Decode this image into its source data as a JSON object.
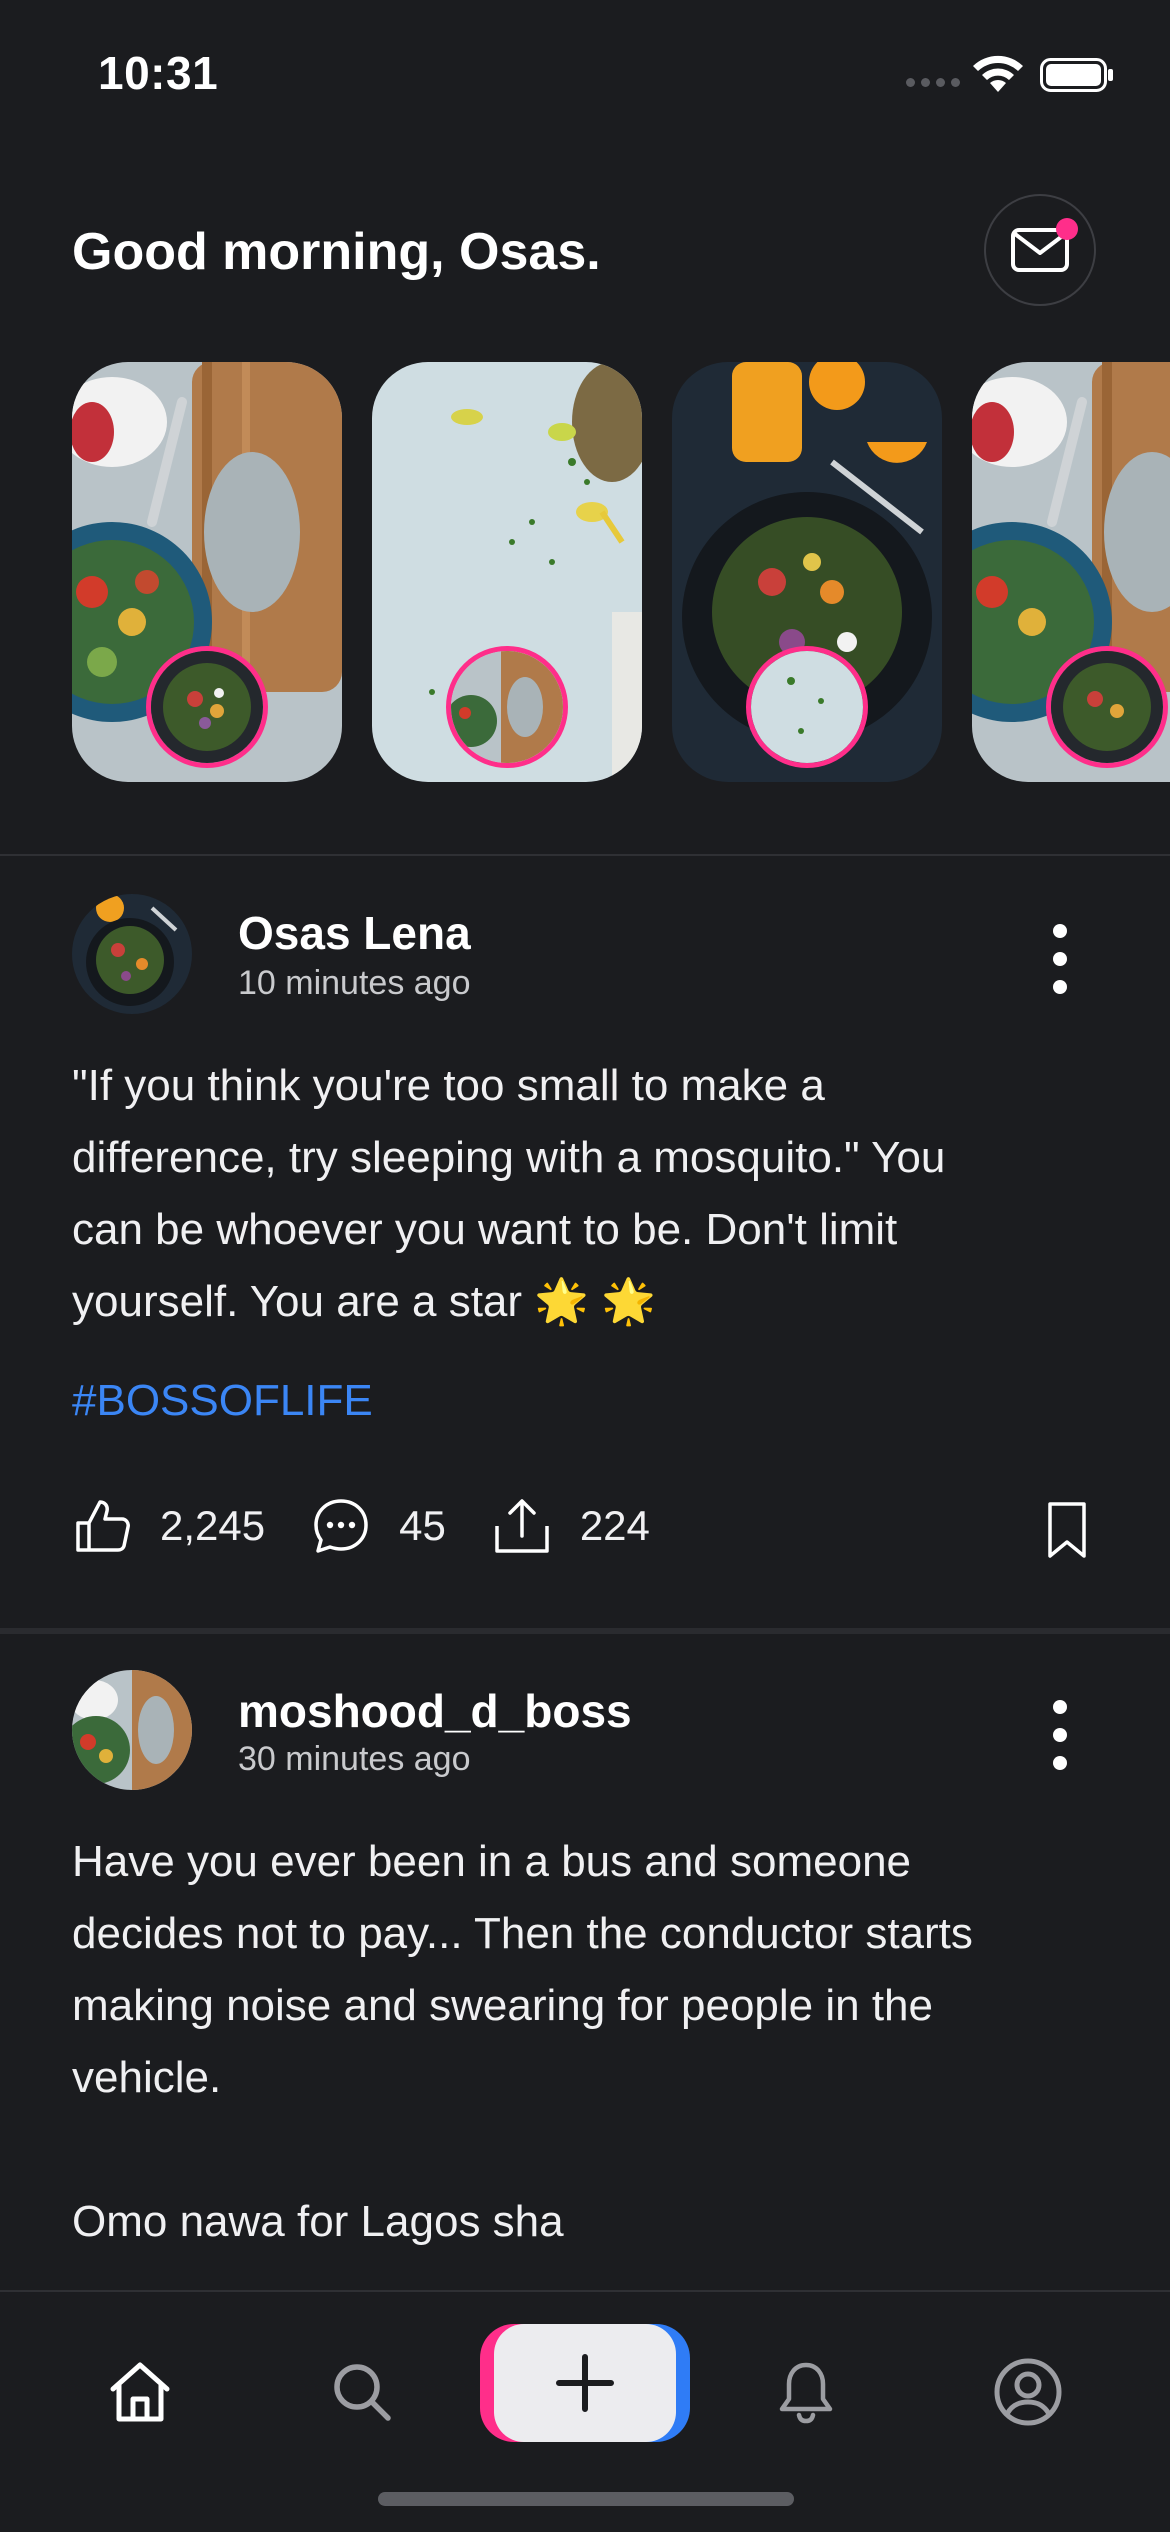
{
  "status_bar": {
    "time": "10:31"
  },
  "header": {
    "greeting": "Good morning, Osas.",
    "mail_icon": "mail-icon",
    "has_unread": true
  },
  "stories": [
    {
      "name": "story-1",
      "theme": "salad-board"
    },
    {
      "name": "story-2",
      "theme": "herbs-lemon"
    },
    {
      "name": "story-3",
      "theme": "salad-plate"
    },
    {
      "name": "story-4",
      "theme": "salad-board"
    }
  ],
  "posts": [
    {
      "author": "Osas Lena",
      "time": "10 minutes ago",
      "text": "\"If you think you're too small to make a\ndifference, try sleeping with a mosquito.\" You\ncan be whoever you want to be. Don't limit\nyourself. You are a star 🌟 🌟",
      "hashtag": "#BOSSOFLIFE",
      "likes": "2,245",
      "comments": "45",
      "shares": "224"
    },
    {
      "author": "moshood_d_boss",
      "time": "30 minutes ago",
      "text": "Have you ever been in a bus and someone\ndecides not to pay... Then the conductor starts\nmaking noise and swearing for people in the\nvehicle.\n\nOmo nawa for Lagos sha"
    }
  ],
  "tabbar": {
    "items": [
      "home-icon",
      "search-icon",
      "compose-icon",
      "bell-icon",
      "profile-icon"
    ],
    "active": "home-icon"
  },
  "colors": {
    "accent_pink": "#ff2e8a",
    "accent_blue": "#2f7cf6",
    "hashtag": "#3b86f5",
    "background": "#1b1c1f"
  }
}
